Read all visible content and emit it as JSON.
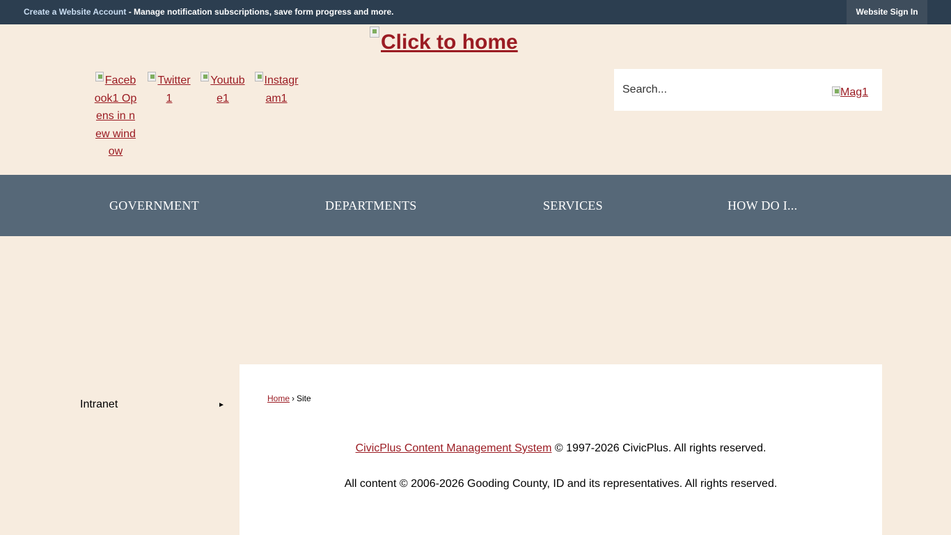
{
  "topbar": {
    "create_account_link": "Create a Website Account",
    "message": " - Manage notification subscriptions, save form progress and more.",
    "sign_in_label": "Website Sign In"
  },
  "header": {
    "logo_alt": "Click to home"
  },
  "social": [
    {
      "label": "Facebook1 Opens in new window",
      "icon": "facebook-icon"
    },
    {
      "label": "Twitter1",
      "icon": "twitter-icon"
    },
    {
      "label": "Youtube1",
      "icon": "youtube-icon"
    },
    {
      "label": "Instagram1",
      "icon": "instagram-icon"
    }
  ],
  "search": {
    "placeholder": "Search...",
    "button_alt": "Mag1"
  },
  "nav": {
    "items": [
      {
        "label": "GOVERNMENT"
      },
      {
        "label": "DEPARTMENTS"
      },
      {
        "label": "SERVICES"
      },
      {
        "label": "HOW DO I..."
      }
    ]
  },
  "sidenav": {
    "items": [
      {
        "label": "Intranet",
        "arrow": "►"
      }
    ]
  },
  "breadcrumb": {
    "home": "Home",
    "separator": "›",
    "current": "Site"
  },
  "footer": {
    "cms_link": "CivicPlus Content Management System",
    "cms_suffix": " © 1997-2026 CivicPlus. All rights reserved.",
    "content_notice": "All content © 2006-2026 Gooding County, ID and its representatives. All rights reserved."
  }
}
